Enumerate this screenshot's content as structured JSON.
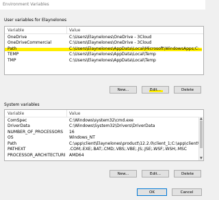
{
  "window": {
    "title": "Environment Variables"
  },
  "user_vars": {
    "group_label": "User variables for Elaynelones",
    "col_variable": "Variable",
    "col_value": "Value",
    "rows": [
      {
        "name": "OneDrive",
        "value": "C:\\Users\\Elaynelones\\OneDrive - 3Cloud"
      },
      {
        "name": "OneDriveCommercial",
        "value": "C:\\Users\\Elaynelones\\OneDrive - 3Cloud"
      },
      {
        "name": "Path",
        "value": "C:\\Users\\Elaynelones\\AppData\\Local\\Microsoft\\WindowsApps;C:..."
      },
      {
        "name": "TEMP",
        "value": "C:\\Users\\Elaynelones\\AppData\\Local\\Temp"
      },
      {
        "name": "TMP",
        "value": "C:\\Users\\Elaynelones\\AppData\\Local\\Temp"
      }
    ],
    "buttons": {
      "new": "New...",
      "edit": "Edit...",
      "delete": "Delete"
    }
  },
  "system_vars": {
    "group_label": "System variables",
    "col_variable": "Variable",
    "col_value": "Value",
    "rows": [
      {
        "name": "ComSpec",
        "value": "C:\\Windows\\system32\\cmd.exe"
      },
      {
        "name": "DriverData",
        "value": "C:\\Windows\\System32\\Drivers\\DriverData"
      },
      {
        "name": "NUMBER_OF_PROCESSORS",
        "value": "16"
      },
      {
        "name": "OS",
        "value": "Windows_NT"
      },
      {
        "name": "Path",
        "value": "C:\\app\\client\\Elaynelones\\product\\12.2.0\\client_1;C:\\app\\client\\El..."
      },
      {
        "name": "PATHEXT",
        "value": ".COM;.EXE;.BAT;.CMD;.VBS;.VBE;.JS;.JSE;.WSF;.WSH;.MSC"
      },
      {
        "name": "PROCESSOR_ARCHITECTURE",
        "value": "AMD64"
      }
    ],
    "buttons": {
      "new": "New...",
      "edit": "Edit...",
      "delete": "Delete"
    }
  },
  "dialog_buttons": {
    "ok": "OK",
    "cancel": "Cancel"
  },
  "colors": {
    "highlight": "#ffee00",
    "accent": "#0078d7"
  }
}
